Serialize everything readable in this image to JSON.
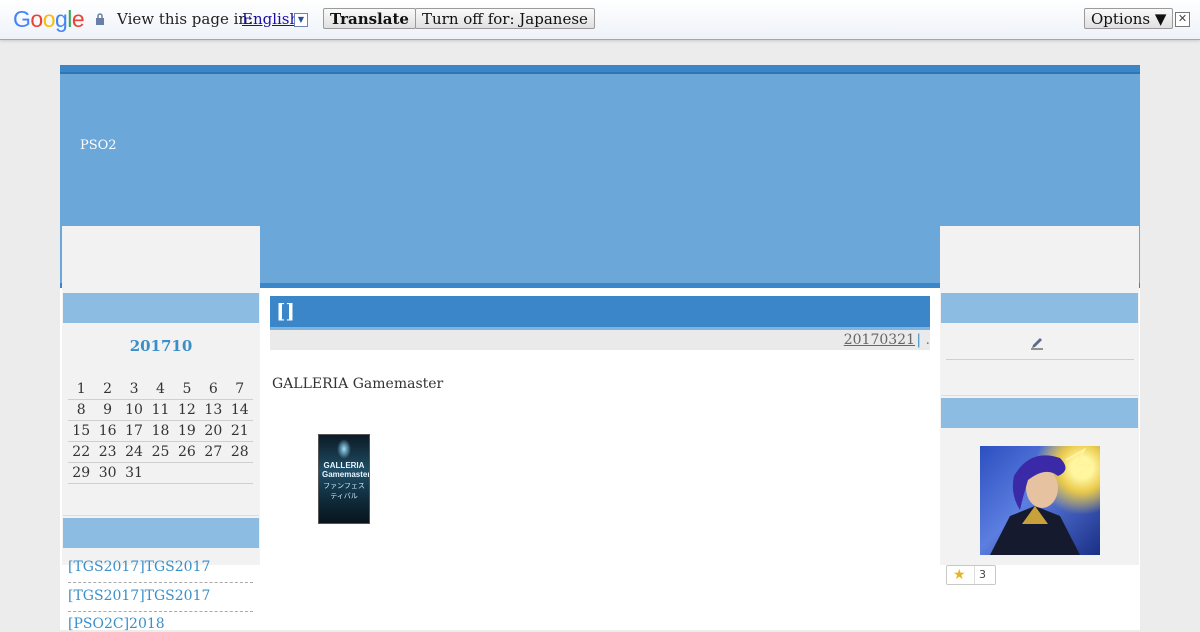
{
  "translate_bar": {
    "logo": "Google",
    "prompt": "View this page in:",
    "language": "English",
    "translate_label": "Translate",
    "turn_off_label": "Turn off for: Japanese",
    "options_label": "Options ▼",
    "close_glyph": "✕"
  },
  "site": {
    "title": "PSO2"
  },
  "calendar": {
    "month_title": "201710",
    "weeks": [
      [
        "1",
        "2",
        "3",
        "4",
        "5",
        "6",
        "7"
      ],
      [
        "8",
        "9",
        "10",
        "11",
        "12",
        "13",
        "14"
      ],
      [
        "15",
        "16",
        "17",
        "18",
        "19",
        "20",
        "21"
      ],
      [
        "22",
        "23",
        "24",
        "25",
        "26",
        "27",
        "28"
      ],
      [
        "29",
        "30",
        "31",
        "",
        "",
        "",
        ""
      ]
    ]
  },
  "recent_posts": [
    "[TGS2017]TGS2017",
    "[TGS2017]TGS2017",
    "[PSO2C]2018"
  ],
  "post": {
    "title": "[]",
    "date": "20170321",
    "meta_sep": "| .",
    "body": "GALLERIA Gamemaster",
    "thumb_line1": "GALLERIA Gamemaster",
    "thumb_line2": "ファンフェスティバル"
  },
  "sidebar": {
    "star_count": "3"
  },
  "colors": {
    "accent": "#3a86c8",
    "header": "#6ba7d8",
    "panel_head": "#8dbce3",
    "link": "#3a8fc9"
  }
}
